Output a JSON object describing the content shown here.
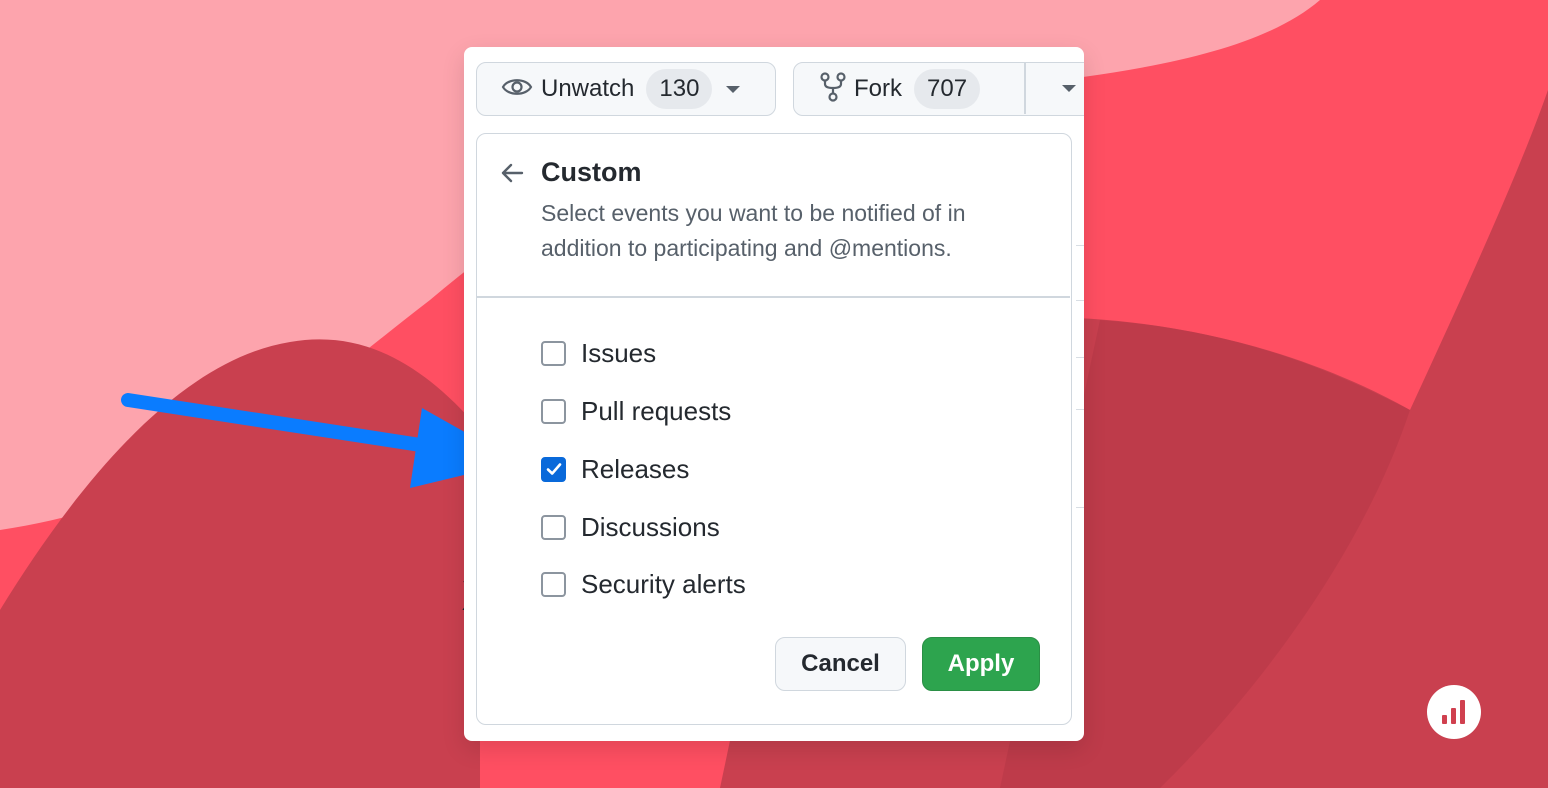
{
  "toolbar": {
    "watch": {
      "label": "Unwatch",
      "count": "130",
      "icon": "eye-icon"
    },
    "fork": {
      "label": "Fork",
      "count": "707",
      "icon": "repo-forked-icon"
    }
  },
  "panel": {
    "title": "Custom",
    "description": "Select events you want to be notified of in addition to participating and @mentions.",
    "options": [
      {
        "label": "Issues",
        "checked": false
      },
      {
        "label": "Pull requests",
        "checked": false
      },
      {
        "label": "Releases",
        "checked": true
      },
      {
        "label": "Discussions",
        "checked": false
      },
      {
        "label": "Security alerts",
        "checked": false
      }
    ],
    "cancel_label": "Cancel",
    "apply_label": "Apply"
  },
  "background": {
    "partial_text": "X"
  },
  "colors": {
    "accent": "#0969da",
    "apply_green": "#2da44e",
    "arrow_blue": "#0a7cff",
    "bg_light": "#fda4ad",
    "bg_mid": "#ff4f62",
    "bg_dark": "#c9404f"
  }
}
